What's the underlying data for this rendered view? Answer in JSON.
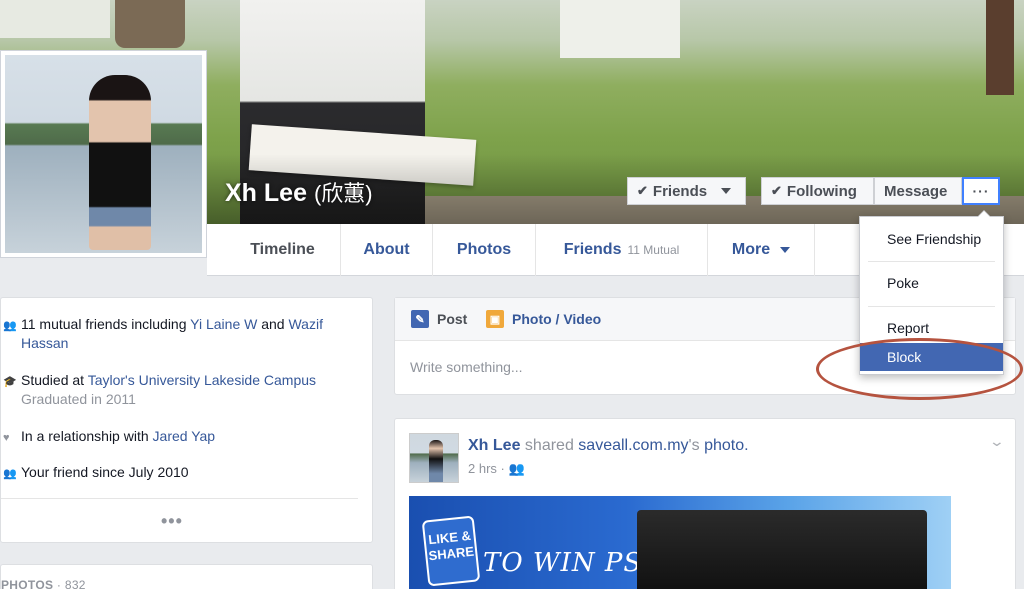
{
  "profile": {
    "name": "Xh Lee",
    "alt_name": "(欣蕙)"
  },
  "cover_actions": {
    "friends_label": "Friends",
    "following_label": "Following",
    "message_label": "Message",
    "more_label": "···"
  },
  "tabs": [
    {
      "label": "Timeline"
    },
    {
      "label": "About"
    },
    {
      "label": "Photos"
    },
    {
      "label": "Friends",
      "sub": "11 Mutual"
    },
    {
      "label": "More"
    }
  ],
  "dropdown": {
    "items": [
      "See Friendship",
      "Poke",
      "Report",
      "Block"
    ],
    "highlighted": "Block"
  },
  "intro": {
    "mutual": {
      "prefix": "11 mutual friends including",
      "friend1": "Yi Laine W",
      "joiner": "and",
      "friend2": "Wazif Hassan"
    },
    "study": {
      "prefix": "Studied at",
      "school": "Taylor's University Lakeside Campus",
      "grad": "Graduated in 2011"
    },
    "relationship": {
      "prefix": "In a relationship with",
      "partner": "Jared Yap"
    },
    "since": "Your friend since July 2010",
    "more": "•••"
  },
  "photos": {
    "label": "PHOTOS",
    "separator": "·",
    "count": "832"
  },
  "composer": {
    "post_label": "Post",
    "photo_video_label": "Photo / Video",
    "placeholder": "Write something..."
  },
  "post": {
    "author": "Xh Lee",
    "verb": "shared",
    "source": "saveall.com.my",
    "suffix": "'s",
    "object": "photo.",
    "time": "2 hrs",
    "image": {
      "badge": "LIKE & SHARE",
      "slogan": "TO WIN PS4"
    }
  },
  "colors": {
    "link": "#365899",
    "highlight": "#4267b2",
    "annotation": "#b5533f"
  }
}
